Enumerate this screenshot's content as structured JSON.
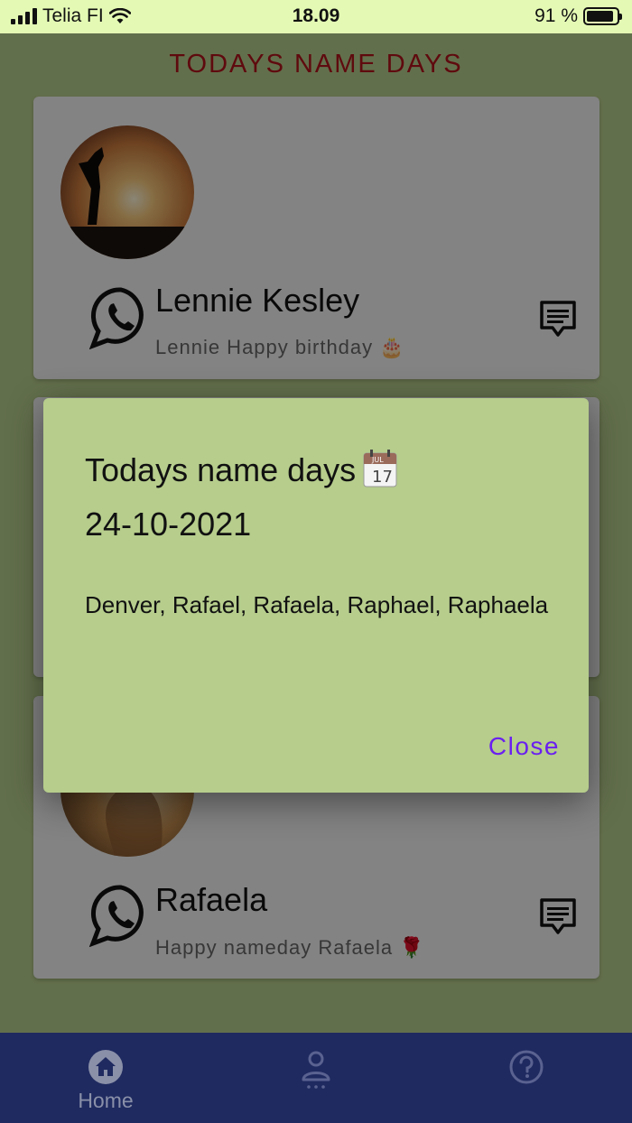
{
  "status_bar": {
    "carrier": "Telia FI",
    "time": "18.09",
    "battery": "91 %",
    "battery_level": 0.91
  },
  "header": {
    "title": "TODAYS NAME DAYS"
  },
  "cards": [
    {
      "name": "Lennie Kesley",
      "message": "Lennie Happy birthday 🎂"
    },
    {
      "name": "Rafaela",
      "message": "Happy nameday Rafaela 🌹"
    }
  ],
  "dialog": {
    "title": "Todays name days",
    "title_icon": "calendar-icon",
    "date": "24-10-2021",
    "names": "Denver, Rafael, Rafaela, Raphael, Raphaela",
    "close_label": "Close"
  },
  "bottom_nav": {
    "items": [
      {
        "label": "Home",
        "icon": "home-icon",
        "active": true
      },
      {
        "label": "",
        "icon": "person-icon"
      },
      {
        "label": "",
        "icon": "help-icon"
      }
    ]
  },
  "colors": {
    "title_red": "#b0141a",
    "dialog_bg": "#b6cd8c",
    "nav_bg": "#1f2a60",
    "close_purple": "#6a1ff0"
  }
}
